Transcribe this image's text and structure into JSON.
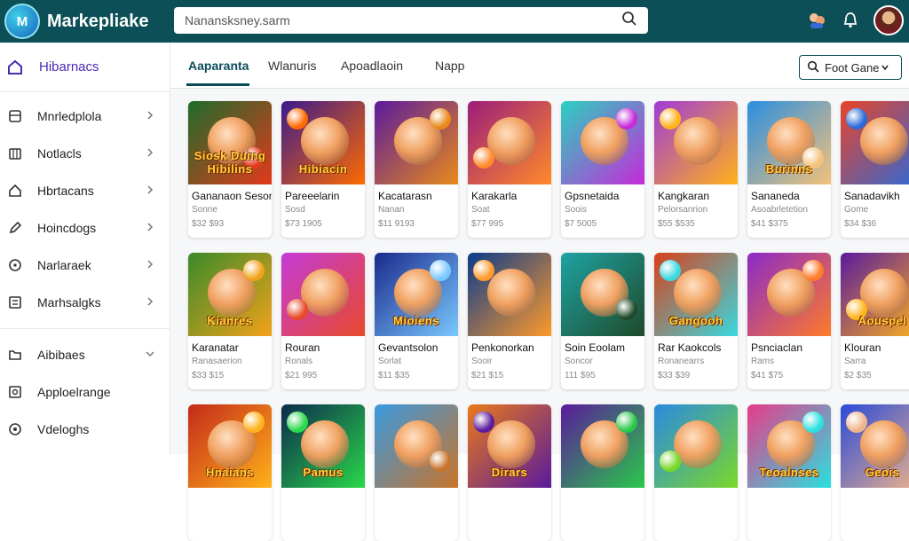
{
  "header": {
    "app_title": "Markepliake",
    "logo_text": "M",
    "search_placeholder": "Nanansksney.sarm"
  },
  "sidebar": {
    "head_label": "Hibarnacs",
    "items": [
      {
        "label": "Mnrledplola",
        "icon": "grid-icon"
      },
      {
        "label": "Notlacls",
        "icon": "bell-icon"
      },
      {
        "label": "Hbrtacans",
        "icon": "home-icon"
      },
      {
        "label": "Hoincdogs",
        "icon": "pen-icon"
      },
      {
        "label": "Narlaraek",
        "icon": "help-icon"
      },
      {
        "label": "Marhsalgks",
        "icon": "list-icon"
      }
    ],
    "items2": [
      {
        "label": "Aibibaes",
        "icon": "folder-icon"
      },
      {
        "label": "Apploelrange",
        "icon": "settings-icon"
      },
      {
        "label": "Vdeloghs",
        "icon": "info-icon"
      }
    ]
  },
  "tabs": [
    {
      "label": "Aaparanta",
      "active": true
    },
    {
      "label": "Wlanuris",
      "active": false
    },
    {
      "label": "Apoadlaoin",
      "active": false
    },
    {
      "label": "Napp",
      "active": false
    }
  ],
  "filter_button": {
    "label": "Foot Gane"
  },
  "cards": [
    {
      "title": "Siosk Duing Hibilins",
      "name": "Gananaon Seson",
      "sub": "Sonne",
      "price": "$32 $93",
      "colors": [
        "#1e6b2a",
        "#e23a1c"
      ]
    },
    {
      "title": "Hibiacin",
      "name": "Pareeelarin",
      "sub": "Sosd",
      "price": "$73 1905",
      "colors": [
        "#3a1a8c",
        "#ff6a00"
      ]
    },
    {
      "title": "",
      "name": "Kacatarasn",
      "sub": "Nanan",
      "price": "$11 9193",
      "colors": [
        "#5b1a9c",
        "#e88a1a"
      ]
    },
    {
      "title": "",
      "name": "Karakarla",
      "sub": "Soat",
      "price": "$77 995",
      "colors": [
        "#9b1d7a",
        "#ff8a2a"
      ]
    },
    {
      "title": "",
      "name": "Gpsnetaida",
      "sub": "Soois",
      "price": "$7 5005",
      "colors": [
        "#2ad1c0",
        "#c52bd8"
      ]
    },
    {
      "title": "",
      "name": "Kangkaran",
      "sub": "Pelorsanrion",
      "price": "$55 $535",
      "colors": [
        "#a03bd6",
        "#ffb21a"
      ]
    },
    {
      "title": "Burinns",
      "name": "Sananeda",
      "sub": "Asoabrletetion",
      "price": "$41 $375",
      "colors": [
        "#2a8ee0",
        "#f4c27a"
      ]
    },
    {
      "title": "",
      "name": "Sanadavikh",
      "sub": "Gome",
      "price": "$34 $36",
      "colors": [
        "#e8442a",
        "#2a6ad8"
      ]
    },
    {
      "title": "Kianres",
      "name": "Karanatar",
      "sub": "Ranasaerion",
      "price": "$33 $15",
      "colors": [
        "#3a8a2a",
        "#f2a21a"
      ]
    },
    {
      "title": "",
      "name": "Rouran",
      "sub": "Ronals",
      "price": "$21 995",
      "colors": [
        "#c43ad8",
        "#e84a2a"
      ]
    },
    {
      "title": "Mioiens",
      "name": "Gevantsolon",
      "sub": "Sorlat",
      "price": "$11 $35",
      "colors": [
        "#1a2a8c",
        "#7ac8ff"
      ]
    },
    {
      "title": "",
      "name": "Penkonorkan",
      "sub": "Sooir",
      "price": "$21 $15",
      "colors": [
        "#0a3a8c",
        "#ff9a2a"
      ]
    },
    {
      "title": "",
      "name": "Soin Eoolam",
      "sub": "Soncor",
      "price": "111 $95",
      "colors": [
        "#1ea3a3",
        "#1e4a2a"
      ]
    },
    {
      "title": "Gangooh",
      "name": "Rar Kaokcols",
      "sub": "Ronanearrs",
      "price": "$33 $39",
      "colors": [
        "#d8401a",
        "#3ad8e0"
      ]
    },
    {
      "title": "",
      "name": "Psnciaclan",
      "sub": "Rams",
      "price": "$41 $75",
      "colors": [
        "#8a2ac8",
        "#ff7a2a"
      ]
    },
    {
      "title": "Aouspel",
      "name": "Klouran",
      "sub": "Sarra",
      "price": "$2 $35",
      "colors": [
        "#5a1a9c",
        "#ffb41a"
      ]
    },
    {
      "title": "Hnaians",
      "name": "",
      "sub": "",
      "price": "",
      "colors": [
        "#c42a1a",
        "#ffb21a"
      ]
    },
    {
      "title": "Pamus",
      "name": "",
      "sub": "",
      "price": "",
      "colors": [
        "#0c2a4c",
        "#2ad84a"
      ]
    },
    {
      "title": "",
      "name": "",
      "sub": "",
      "price": "",
      "colors": [
        "#3a9ae0",
        "#c8742a"
      ]
    },
    {
      "title": "Dirars",
      "name": "",
      "sub": "",
      "price": "",
      "colors": [
        "#e87a1a",
        "#5a1a9c"
      ]
    },
    {
      "title": "",
      "name": "",
      "sub": "",
      "price": "",
      "colors": [
        "#5a1a9c",
        "#2ac84a"
      ]
    },
    {
      "title": "",
      "name": "",
      "sub": "",
      "price": "",
      "colors": [
        "#2a8ae0",
        "#7ad82a"
      ]
    },
    {
      "title": "Teoalnses",
      "name": "",
      "sub": "",
      "price": "",
      "colors": [
        "#e83a8a",
        "#2ae0e0"
      ]
    },
    {
      "title": "Geois",
      "name": "",
      "sub": "",
      "price": "",
      "colors": [
        "#2a4ad8",
        "#f0b48a"
      ]
    }
  ]
}
